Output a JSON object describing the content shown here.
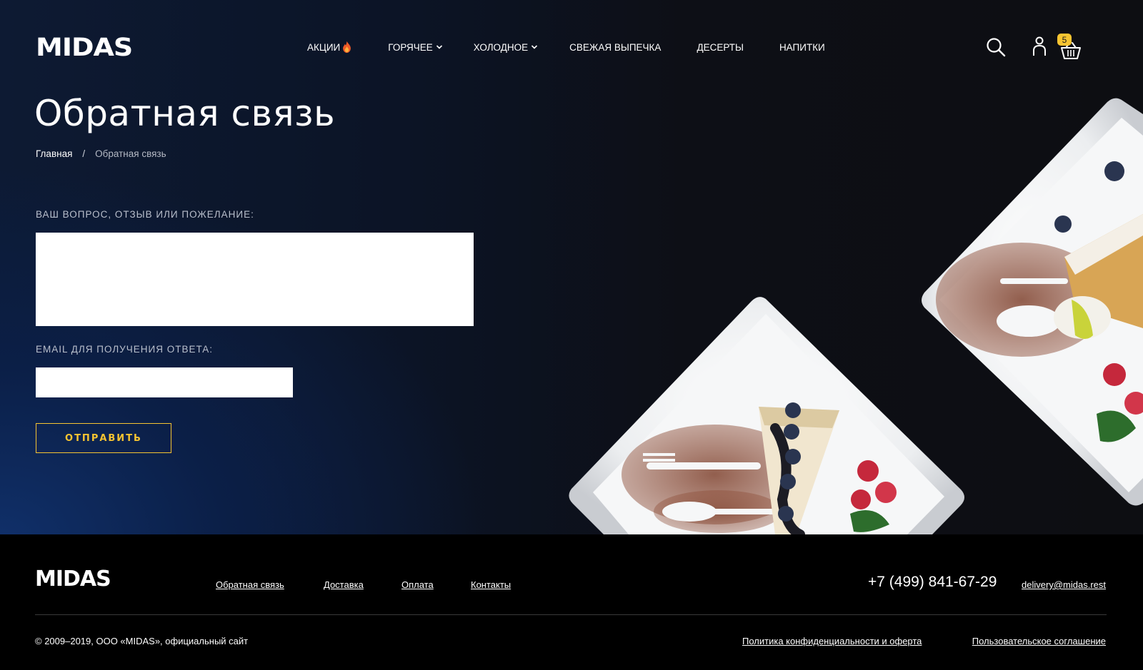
{
  "brand": {
    "logo_text": "MIDAS"
  },
  "nav": {
    "items": [
      {
        "label": "АКЦИИ",
        "icon": "fire-icon"
      },
      {
        "label": "ГОРЯЧЕЕ",
        "icon": "chevron-down-icon"
      },
      {
        "label": "ХОЛОДНОЕ",
        "icon": "chevron-down-icon"
      },
      {
        "label": "СВЕЖАЯ ВЫПЕЧКА"
      },
      {
        "label": "ДЕСЕРТЫ"
      },
      {
        "label": "НАПИТКИ"
      }
    ]
  },
  "header_icons": {
    "search": "search-icon",
    "account": "user-icon",
    "cart": "basket-icon",
    "cart_count": "5"
  },
  "page": {
    "title": "Обратная связь",
    "breadcrumb": {
      "home": "Главная",
      "separator": "/",
      "current": "Обратная связь"
    }
  },
  "form": {
    "question_label": "ВАШ ВОПРОС, ОТЗЫВ ИЛИ ПОЖЕЛАНИЕ:",
    "question_value": "",
    "email_label": "EMAIL ДЛЯ ПОЛУЧЕНИЯ ОТВЕТА:",
    "email_value": "",
    "submit_label": "ОТПРАВИТЬ"
  },
  "footer": {
    "logo_text": "MIDAS",
    "links": [
      "Обратная связь",
      "Доставка",
      "Оплата",
      "Контакты"
    ],
    "phone": "+7 (499) 841-67-29",
    "email": "delivery@midas.rest",
    "copyright": "© 2009–2019, ООО «MIDAS», официальный сайт",
    "legal_links": [
      "Политика конфиденциальности и оферта",
      "Пользовательское соглашение"
    ]
  },
  "colors": {
    "accent": "#f6c431",
    "hero_blue": "#10306a",
    "background": "#0d0e12",
    "footer_bg": "#000000"
  }
}
